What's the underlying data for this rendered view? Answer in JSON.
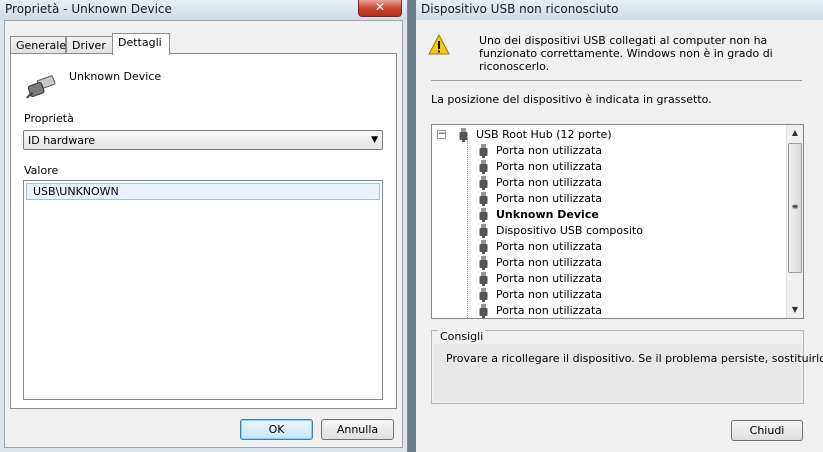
{
  "left_window": {
    "title": "Proprietà - Unknown Device",
    "close_glyph": "✕",
    "tabs": [
      "Generale",
      "Driver",
      "Dettagli"
    ],
    "selected_tab": "Dettagli",
    "device_name": "Unknown Device",
    "property_label": "Proprietà",
    "property_value": "ID hardware",
    "value_label": "Valore",
    "values": [
      "USB\\UNKNOWN"
    ],
    "ok_label": "OK",
    "cancel_label": "Annulla"
  },
  "right_window": {
    "title": "Dispositivo USB non riconosciuto",
    "message": "Uno dei dispositivi USB collegati al computer non ha funzionato correttamente. Windows non è in grado di riconoscerlo.",
    "location_text": "La posizione del dispositivo è indicata in grassetto.",
    "tree": {
      "root": "USB Root Hub (12 porte)",
      "expander": "−",
      "children": [
        {
          "label": "Porta non utilizzata",
          "bold": false
        },
        {
          "label": "Porta non utilizzata",
          "bold": false
        },
        {
          "label": "Porta non utilizzata",
          "bold": false
        },
        {
          "label": "Porta non utilizzata",
          "bold": false
        },
        {
          "label": "Unknown Device",
          "bold": true
        },
        {
          "label": "Dispositivo USB composito",
          "bold": false
        },
        {
          "label": "Porta non utilizzata",
          "bold": false
        },
        {
          "label": "Porta non utilizzata",
          "bold": false
        },
        {
          "label": "Porta non utilizzata",
          "bold": false
        },
        {
          "label": "Porta non utilizzata",
          "bold": false
        },
        {
          "label": "Porta non utilizzata",
          "bold": false
        }
      ]
    },
    "advice_label": "Consigli",
    "advice_text": "Provare a ricollegare il dispositivo. Se il problema persiste, sostituirlo.",
    "close_label": "Chiudi"
  },
  "icons": {
    "usb_device": "usb-plug-icon",
    "warning": "warning-icon",
    "tree_node": "usb-connector-icon"
  },
  "colors": {
    "selection_bg": "#e8f2fc",
    "title_close": "#c8412d",
    "warning_yellow": "#f5c518"
  }
}
